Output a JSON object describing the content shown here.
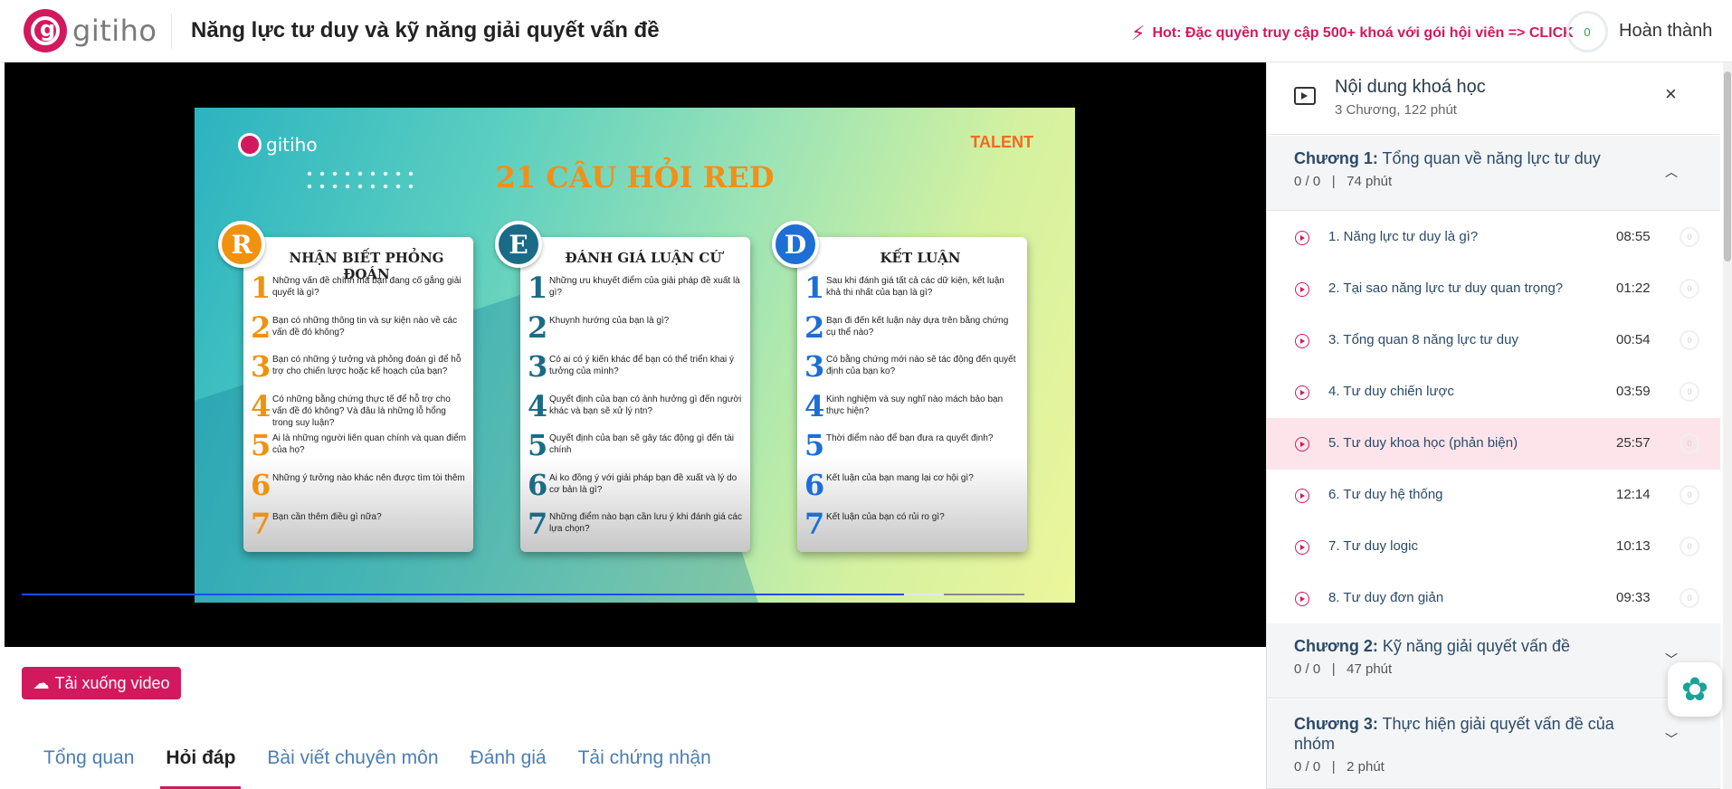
{
  "header": {
    "logo_text": "gitiho",
    "course_title": "Năng lực tư duy và kỹ năng giải quyết vấn đề",
    "hot_promo": "Hot: Đặc quyền truy cập 500+ khoá với gói hội viên => CLICK",
    "progress_value": "0",
    "progress_label": "Hoàn thành"
  },
  "video": {
    "slide": {
      "logo_text": "gitiho",
      "talent_logo": "TALENT",
      "title": "21 CÂU HỎI RED",
      "cards": [
        {
          "letter": "R",
          "title": "NHẬN BIẾT PHỎNG ĐOÁN",
          "color": "#f0920f",
          "questions": [
            {
              "n": "1",
              "text": "Những vấn đề chính mà bạn đang cố gắng giải quyết là gì?"
            },
            {
              "n": "2",
              "text": "Bạn có những thông tin và sự kiện nào về các vấn đề đó không?"
            },
            {
              "n": "3",
              "text": "Bạn có những ý tưởng và phỏng đoán gì để hỗ trợ cho chiến lược hoặc kế hoạch của bạn?"
            },
            {
              "n": "4",
              "text": "Có những bằng chứng thực tế để hỗ trợ cho vấn đề đó không? Và đâu là những lỗ hổng trong suy luận?"
            },
            {
              "n": "5",
              "text": "Ai là những người liên quan chính và quan điểm của họ?"
            },
            {
              "n": "6",
              "text": "Những ý tưởng nào khác nên được tìm tòi thêm"
            },
            {
              "n": "7",
              "text": "Bạn cần thêm điều gì nữa?"
            }
          ]
        },
        {
          "letter": "E",
          "title": "ĐÁNH GIÁ LUẬN CỨ",
          "color": "#1b6b86",
          "questions": [
            {
              "n": "1",
              "text": "Những ưu khuyết điểm của giải pháp đề xuất là gì?"
            },
            {
              "n": "2",
              "text": "Khuynh hướng của bạn là gì?"
            },
            {
              "n": "3",
              "text": "Có ai có ý kiến khác để bạn có thể triển khai ý tưởng của mình?"
            },
            {
              "n": "4",
              "text": "Quyết định của bạn có ảnh hưởng gì đến người khác và bạn sẽ xử lý ntn?"
            },
            {
              "n": "5",
              "text": "Quyết định của bạn sẽ gây tác động gì đến tài chính"
            },
            {
              "n": "6",
              "text": "Ai ko đồng ý với giải pháp bạn đề xuất và lý do cơ bản là gì?"
            },
            {
              "n": "7",
              "text": "Những điểm nào bạn cần lưu ý khi đánh giá các lựa chọn?"
            }
          ]
        },
        {
          "letter": "D",
          "title": "KẾT LUẬN",
          "color": "#1d6fd6",
          "questions": [
            {
              "n": "1",
              "text": "Sau khi đánh giá tất cả các dữ kiện, kết luận khả thi nhất của bạn là gì?"
            },
            {
              "n": "2",
              "text": "Bạn đi đến kết luận này dựa trên bằng chứng cụ thể nào?"
            },
            {
              "n": "3",
              "text": "Có bằng chứng mới nào sẽ tác động đến quyết định của bạn ko?"
            },
            {
              "n": "4",
              "text": "Kinh nghiệm và suy nghĩ nào mách bảo bạn thực hiện?"
            },
            {
              "n": "5",
              "text": "Thời điểm nào để bạn đưa ra quyết định?"
            },
            {
              "n": "6",
              "text": "Kết luận của bạn mang lại cơ hội gì?"
            },
            {
              "n": "7",
              "text": "Kết luận của bạn có rủi ro gì?"
            }
          ]
        }
      ]
    },
    "played_fraction": 0.88,
    "buffered_fraction": 0.92
  },
  "actions": {
    "download_label": "Tải xuống video"
  },
  "tabs": [
    {
      "label": "Tổng quan",
      "active": false
    },
    {
      "label": "Hỏi đáp",
      "active": true
    },
    {
      "label": "Bài viết chuyên môn",
      "active": false
    },
    {
      "label": "Đánh giá",
      "active": false
    },
    {
      "label": "Tải chứng nhận",
      "active": false
    }
  ],
  "sidebar": {
    "title": "Nội dung khoá học",
    "subtitle": "3 Chương, 122 phút",
    "close_icon": "×",
    "chapters": [
      {
        "label": "Chương 1:",
        "name": "Tổng quan về năng lực tư duy",
        "progress": "0 / 0",
        "separator": "|",
        "duration": "74 phút",
        "expanded": true,
        "lessons": [
          {
            "title": "1. Năng lực tư duy là gì?",
            "time": "08:55"
          },
          {
            "title": "2. Tại sao năng lực tư duy quan trọng?",
            "time": "01:22"
          },
          {
            "title": "3. Tổng quan 8 năng lực tư duy",
            "time": "00:54"
          },
          {
            "title": "4. Tư duy chiến lược",
            "time": "03:59"
          },
          {
            "title": "5. Tư duy khoa học (phản biện)",
            "time": "25:57",
            "active": true
          },
          {
            "title": "6. Tư duy hệ thống",
            "time": "12:14"
          },
          {
            "title": "7. Tư duy logic",
            "time": "10:13"
          },
          {
            "title": "8. Tư duy đơn giản",
            "time": "09:33"
          }
        ]
      },
      {
        "label": "Chương 2:",
        "name": "Kỹ năng giải quyết vấn đề",
        "progress": "0 / 0",
        "separator": "|",
        "duration": "47 phút",
        "expanded": false
      },
      {
        "label": "Chương 3:",
        "name": "Thực hiện giải quyết vấn đề của nhóm",
        "progress": "0 / 0",
        "separator": "|",
        "duration": "2 phút",
        "expanded": false
      }
    ],
    "lesson_check_value": "0"
  },
  "icons": {
    "bolt": "bolt-icon",
    "download": "cloud-download-icon",
    "chat": "chatbot-icon"
  },
  "colors": {
    "brand": "#d3195d",
    "active_lesson_bg": "#fde4ea",
    "tab_link": "#4a7eb5"
  }
}
